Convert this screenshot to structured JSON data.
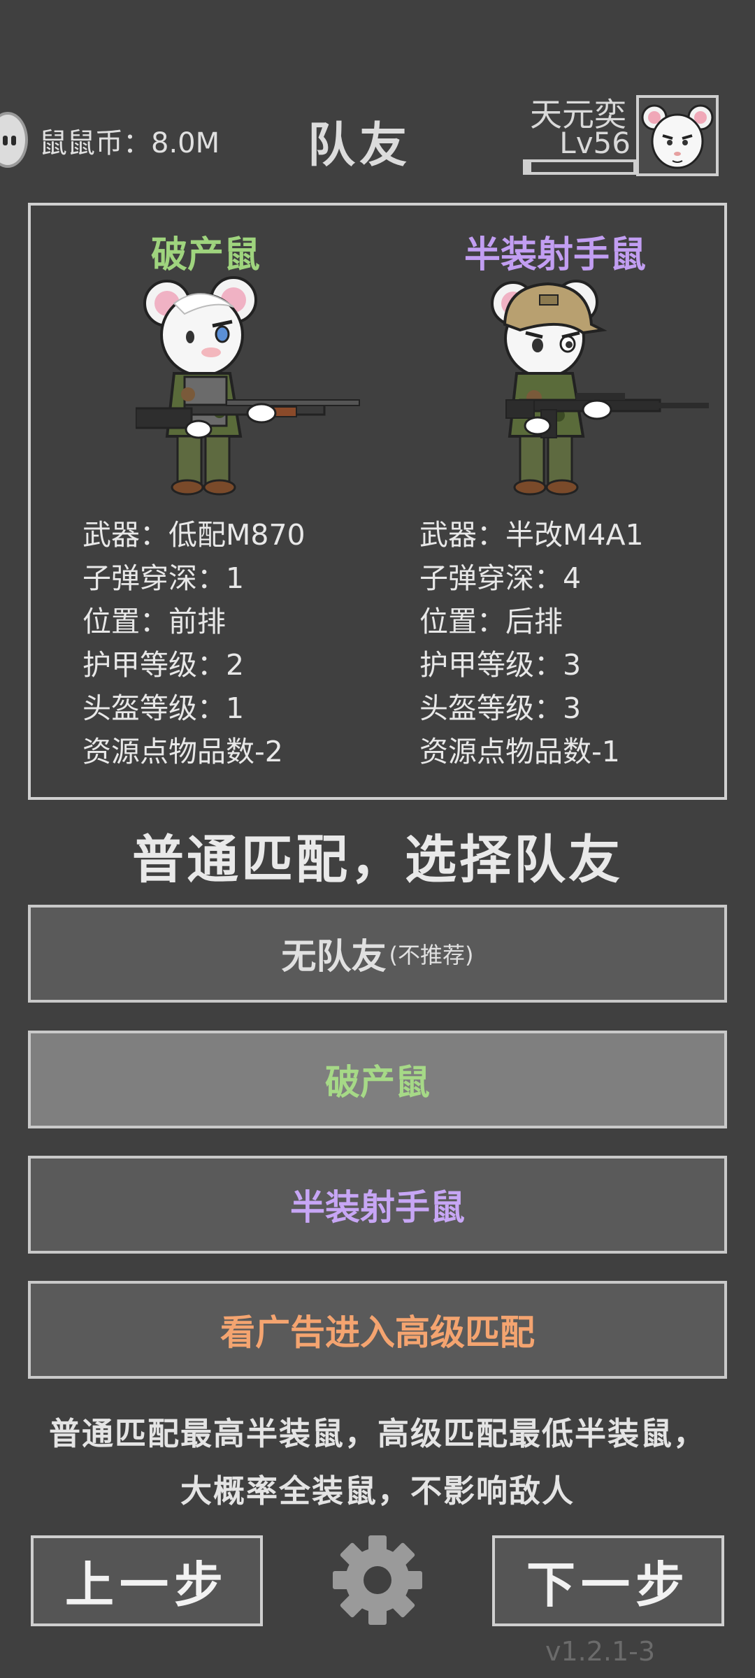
{
  "header": {
    "coin_label": "鼠鼠币：",
    "coin_value": "8.0M",
    "title": "队友",
    "user_name": "天元奕",
    "user_level": "Lv56",
    "xp_progress": 0.05
  },
  "team": [
    {
      "name": "破产鼠",
      "name_color": "#9fd47e",
      "stats": [
        "武器：低配M870",
        "子弹穿深：1",
        "位置：前排",
        "护甲等级：2",
        "头盔等级：1",
        "资源点物品数-2"
      ]
    },
    {
      "name": "半装射手鼠",
      "name_color": "#c29ef2",
      "stats": [
        "武器：半改M4A1",
        "子弹穿深：4",
        "位置：后排",
        "护甲等级：3",
        "头盔等级：3",
        "资源点物品数-1"
      ]
    }
  ],
  "heading": "普通匹配，选择队友",
  "options": {
    "no_teammate": "无队友",
    "no_teammate_note": "(不推荐)",
    "option_1": "破产鼠",
    "option_2": "半装射手鼠",
    "ad_match": "看广告进入高级匹配"
  },
  "option_colors": {
    "no_teammate": "#e0e0e0",
    "option_1": "#a6d987",
    "option_2": "#c7a6f5",
    "ad_match": "#f4a470"
  },
  "note": "普通匹配最高半装鼠，高级匹配最低半装鼠，大概率全装鼠，不影响敌人",
  "nav": {
    "prev": "上一步",
    "next": "下一步"
  },
  "version": "v1.2.1-3",
  "icons": [
    "coin-icon",
    "avatar-mouse-icon",
    "settings-gear-icon"
  ]
}
